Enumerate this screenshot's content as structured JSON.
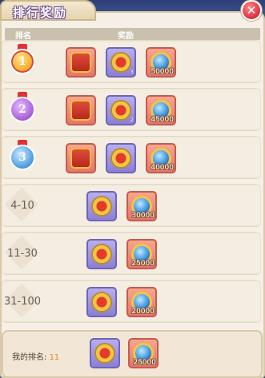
{
  "title": "排行奖励",
  "close_label": "✕",
  "header": {
    "rank": "排名",
    "reward": "奖励"
  },
  "rows": [
    {
      "rank": "1",
      "medal": "gold",
      "rewards": [
        {
          "type": "chest",
          "frame": "red",
          "qty": ""
        },
        {
          "type": "token",
          "frame": "purple",
          "qty": "3"
        },
        {
          "type": "orb",
          "frame": "red",
          "qty": "50000"
        }
      ]
    },
    {
      "rank": "2",
      "medal": "purple",
      "rewards": [
        {
          "type": "chest",
          "frame": "red",
          "qty": ""
        },
        {
          "type": "token",
          "frame": "purple",
          "qty": "2"
        },
        {
          "type": "orb",
          "frame": "red",
          "qty": "45000"
        }
      ]
    },
    {
      "rank": "3",
      "medal": "blue",
      "rewards": [
        {
          "type": "chest",
          "frame": "red",
          "qty": ""
        },
        {
          "type": "token",
          "frame": "purple",
          "qty": ""
        },
        {
          "type": "orb",
          "frame": "red",
          "qty": "40000"
        }
      ]
    },
    {
      "rank": "4-10",
      "medal": "",
      "rewards": [
        {
          "type": "token",
          "frame": "purple",
          "qty": ""
        },
        {
          "type": "orb",
          "frame": "red",
          "qty": "30000"
        }
      ]
    },
    {
      "rank": "11-30",
      "medal": "",
      "rewards": [
        {
          "type": "token",
          "frame": "purple",
          "qty": ""
        },
        {
          "type": "orb",
          "frame": "red",
          "qty": "25000"
        }
      ]
    },
    {
      "rank": "31-100",
      "medal": "",
      "rewards": [
        {
          "type": "token",
          "frame": "purple",
          "qty": ""
        },
        {
          "type": "orb",
          "frame": "red",
          "qty": "20000"
        }
      ]
    }
  ],
  "footer": {
    "label": "我的排名:",
    "rank": "11",
    "rewards": [
      {
        "type": "token",
        "frame": "purple",
        "qty": ""
      },
      {
        "type": "orb",
        "frame": "red",
        "qty": "25000"
      }
    ]
  },
  "colors": {
    "accent_orange": "#e28a1a",
    "close_red": "#e23a45",
    "panel_bg": "#f5efe6"
  }
}
